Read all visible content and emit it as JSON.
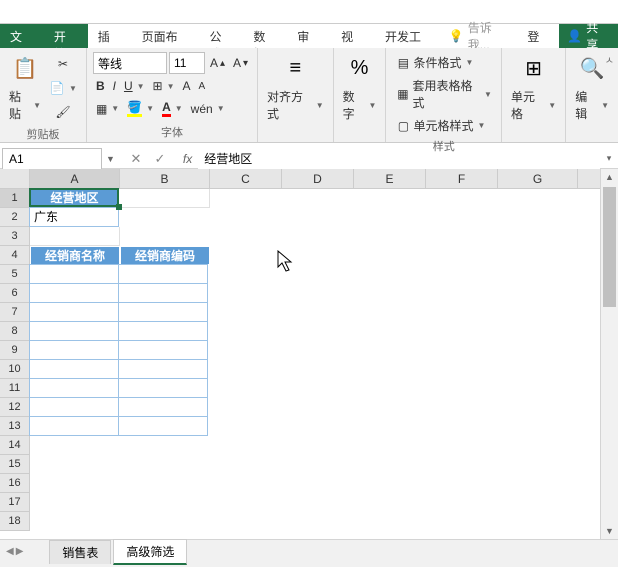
{
  "menu": {
    "file": "文件",
    "home": "开始",
    "insert": "插入",
    "layout": "页面布局",
    "formula": "公式",
    "data": "数据",
    "review": "审阅",
    "view": "视图",
    "dev": "开发工具",
    "tell": "告诉我...",
    "login": "登录",
    "share": "共享"
  },
  "ribbon": {
    "clipboard": {
      "paste": "粘贴",
      "label": "剪贴板"
    },
    "font": {
      "name": "等线",
      "size": "11",
      "label": "字体",
      "ruby": "wén"
    },
    "align": {
      "label": "对齐方式"
    },
    "number": {
      "label": "数字",
      "symbol": "%"
    },
    "styles": {
      "cond": "条件格式",
      "table": "套用表格格式",
      "cell": "单元格样式",
      "label": "样式"
    },
    "cells": {
      "label": "单元格"
    },
    "editing": {
      "label": "编辑"
    }
  },
  "namebox": "A1",
  "formula": "经营地区",
  "columns": [
    "A",
    "B",
    "C",
    "D",
    "E",
    "F",
    "G"
  ],
  "rows": [
    1,
    2,
    3,
    4,
    5,
    6,
    7,
    8,
    9,
    10,
    11,
    12,
    13,
    14,
    15,
    16,
    17,
    18
  ],
  "cells": {
    "a1": "经营地区",
    "a2": "广东",
    "a4": "经销商名称",
    "b4": "经销商编码"
  },
  "sheets": {
    "s1": "销售表",
    "s2": "高级筛选"
  }
}
